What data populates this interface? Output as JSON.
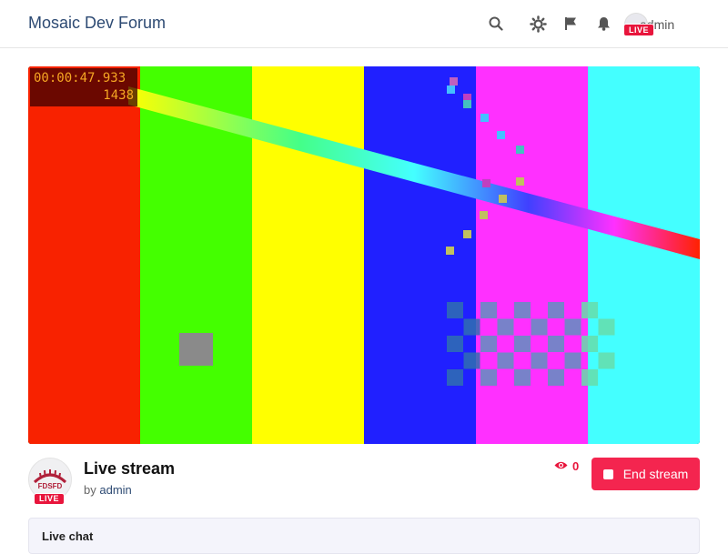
{
  "header": {
    "site_title": "Mosaic Dev Forum",
    "icons": [
      "search-icon",
      "theme-icon",
      "flag-icon",
      "bell-icon"
    ],
    "user": {
      "name": "admin",
      "live_badge": "LIVE"
    }
  },
  "video": {
    "timecode": "00:00:47.933",
    "frame": "1438",
    "bar_colors": [
      "#f82200",
      "#44ff00",
      "#ffff00",
      "#2020ff",
      "#ff30ff",
      "#44ffff"
    ]
  },
  "stream": {
    "title": "Live stream",
    "by_label": "by",
    "author": "admin",
    "viewer_count": "0",
    "end_button_label": "End stream",
    "channel_live_badge": "LIVE",
    "channel_avatar_text": "FDSFD"
  },
  "chat": {
    "title": "Live chat"
  },
  "colors": {
    "accent": "#f4254f",
    "live_red": "#e8153c",
    "title_blue": "#2d4a73"
  }
}
